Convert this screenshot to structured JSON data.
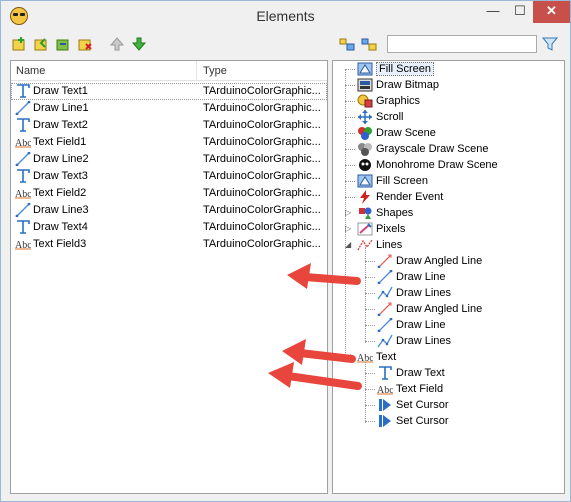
{
  "window": {
    "title": "Elements",
    "minimize_glyph": "—",
    "maximize_glyph": "☐",
    "close_glyph": "✕"
  },
  "search": {
    "value": "",
    "placeholder": ""
  },
  "table": {
    "columns": [
      "Name",
      "Type"
    ],
    "rows": [
      {
        "name": "Draw Text1",
        "type": "TArduinoColorGraphic...",
        "icon": "draw-text-icon"
      },
      {
        "name": "Draw Line1",
        "type": "TArduinoColorGraphic...",
        "icon": "draw-line-icon"
      },
      {
        "name": "Draw Text2",
        "type": "TArduinoColorGraphic...",
        "icon": "draw-text-icon"
      },
      {
        "name": "Text Field1",
        "type": "TArduinoColorGraphic...",
        "icon": "text-field-icon"
      },
      {
        "name": "Draw Line2",
        "type": "TArduinoColorGraphic...",
        "icon": "draw-line-icon"
      },
      {
        "name": "Draw Text3",
        "type": "TArduinoColorGraphic...",
        "icon": "draw-text-icon"
      },
      {
        "name": "Text Field2",
        "type": "TArduinoColorGraphic...",
        "icon": "text-field-icon"
      },
      {
        "name": "Draw Line3",
        "type": "TArduinoColorGraphic...",
        "icon": "draw-line-icon"
      },
      {
        "name": "Draw Text4",
        "type": "TArduinoColorGraphic...",
        "icon": "draw-text-icon"
      },
      {
        "name": "Text Field3",
        "type": "TArduinoColorGraphic...",
        "icon": "text-field-icon"
      }
    ]
  },
  "tree": {
    "top": [
      {
        "label": "Fill Screen",
        "icon": "fill-screen-icon",
        "selected": true
      },
      {
        "label": "Draw Bitmap",
        "icon": "draw-bitmap-icon"
      },
      {
        "label": "Graphics",
        "icon": "graphics-icon"
      },
      {
        "label": "Scroll",
        "icon": "scroll-icon"
      },
      {
        "label": "Draw Scene",
        "icon": "draw-scene-icon"
      },
      {
        "label": "Grayscale Draw Scene",
        "icon": "grayscale-scene-icon"
      },
      {
        "label": "Monohrome Draw Scene",
        "icon": "monochrome-scene-icon"
      },
      {
        "label": "Fill Screen",
        "icon": "fill-screen-icon"
      },
      {
        "label": "Render Event",
        "icon": "render-event-icon"
      },
      {
        "label": "Shapes",
        "icon": "shapes-icon",
        "expander": "▷"
      },
      {
        "label": "Pixels",
        "icon": "pixels-icon",
        "expander": "▷"
      },
      {
        "label": "Lines",
        "icon": "lines-icon",
        "expander": "◢"
      }
    ],
    "lines_children": [
      {
        "label": "Draw Angled Line",
        "icon": "draw-angled-line-icon"
      },
      {
        "label": "Draw Line",
        "icon": "draw-line-icon"
      },
      {
        "label": "Draw Lines",
        "icon": "draw-lines-icon"
      },
      {
        "label": "Draw Angled Line",
        "icon": "draw-angled-line-icon"
      },
      {
        "label": "Draw Line",
        "icon": "draw-line-icon"
      },
      {
        "label": "Draw Lines",
        "icon": "draw-lines-icon"
      }
    ],
    "text_group": {
      "label": "Text",
      "icon": "text-group-icon",
      "expander": "◢"
    },
    "text_children": [
      {
        "label": "Draw Text",
        "icon": "draw-text-icon"
      },
      {
        "label": "Text Field",
        "icon": "text-field-icon"
      },
      {
        "label": "Set Cursor",
        "icon": "set-cursor-icon"
      },
      {
        "label": "Set Cursor",
        "icon": "set-cursor-icon"
      }
    ]
  },
  "colors": {
    "arrow": "#e8463c",
    "close": "#c7504a"
  }
}
